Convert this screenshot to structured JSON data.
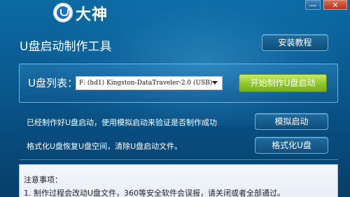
{
  "app": {
    "brand": "大神",
    "minimize_symbol": "—",
    "close_symbol": "✕"
  },
  "header": {
    "title": "U盘启动制作工具",
    "tutorial_label": "安装教程"
  },
  "device_panel": {
    "label": "U盘列表：",
    "selected_device": "F: (hd1) Kingston-DataTraveler-2.0 (USB)",
    "start_label": "开始制作U盘启动"
  },
  "actions": {
    "simulate_desc": "已经制作好U盘启动，使用模拟启动来验证是否制作成功",
    "simulate_label": "模拟启动",
    "format_desc": "格式化U盘恢复U盘空间，清除U盘启动文件。",
    "format_label": "格式化U盘"
  },
  "notes": {
    "title": "注意事项：",
    "items": [
      "1. 制作过程会改动U盘文件，360等安全软件会误报，请关闭或者全部通过。"
    ]
  },
  "colors": {
    "background": "#0a5a8e",
    "start_button": "#8fc52c",
    "close_button": "#c44a33"
  },
  "icons": {
    "logo": "dashen-logo-icon",
    "dropdown": "chevron-down-icon"
  }
}
